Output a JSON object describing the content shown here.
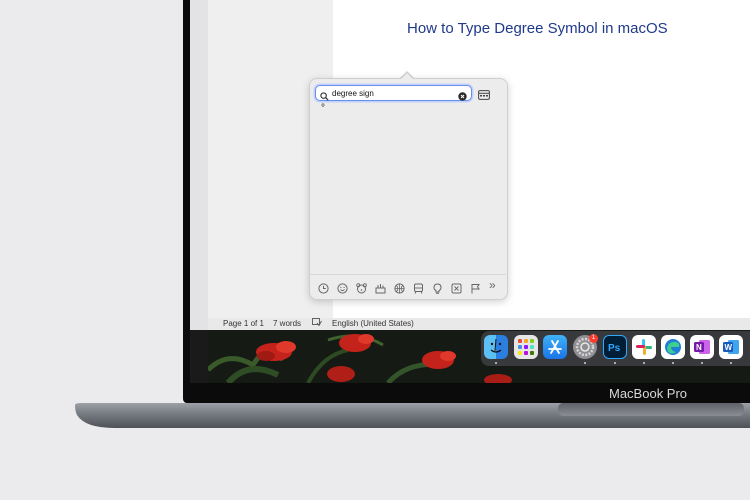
{
  "document": {
    "title": "How to Type Degree Symbol in macOS"
  },
  "status_bar": {
    "page": "Page 1 of 1",
    "words": "7 words",
    "language": "English (United States)"
  },
  "character_viewer": {
    "search_value": "degree sign",
    "result_glyph": "°",
    "categories": [
      "recent-icon",
      "smileys-icon",
      "animals-icon",
      "food-icon",
      "activity-icon",
      "travel-icon",
      "objects-icon",
      "symbols-icon",
      "flags-icon",
      "more-icon"
    ],
    "more_glyph": "»"
  },
  "dock": {
    "apps": [
      "finder",
      "launchpad",
      "app-store",
      "system-preferences",
      "photoshop",
      "slack",
      "edge",
      "onenote",
      "word"
    ],
    "system_preferences_badge": "1"
  },
  "laptop": {
    "model": "MacBook Pro"
  }
}
